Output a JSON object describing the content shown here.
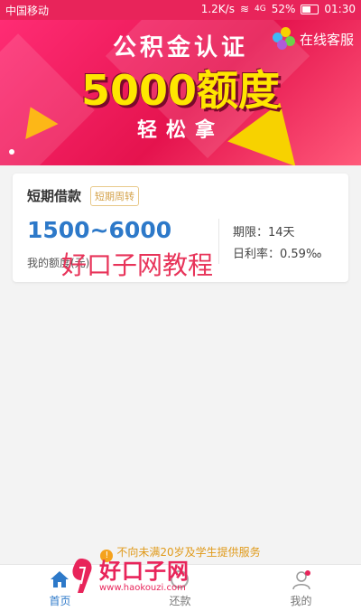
{
  "status_bar": {
    "carrier": "中国移动",
    "speed": "1.2K/s",
    "signal": "4G",
    "battery": "52%",
    "time": "01:30"
  },
  "banner": {
    "headline": "公积金认证",
    "amount": "5000额度",
    "subline": "轻松拿",
    "service_label": "在线客服"
  },
  "loan_card": {
    "title": "短期借款",
    "tag": "短期周转",
    "range": "1500~6000",
    "range_label": "我的额度(元)",
    "term": "期限：14天",
    "daily_rate": "日利率：0.59‰"
  },
  "watermark": {
    "center": "好口子网教程",
    "logo_name": "好口子网",
    "logo_url": "www.haokouzi.com"
  },
  "notice": "不向未满20岁及学生提供服务",
  "tabs": [
    {
      "label": "首页",
      "icon": "home-icon",
      "active": true
    },
    {
      "label": "还款",
      "icon": "repay-icon",
      "active": false
    },
    {
      "label": "我的",
      "icon": "user-icon",
      "active": false
    }
  ],
  "colors": {
    "brand": "#e8245a",
    "accent_blue": "#2d79c9",
    "notice": "#e09a1a"
  }
}
